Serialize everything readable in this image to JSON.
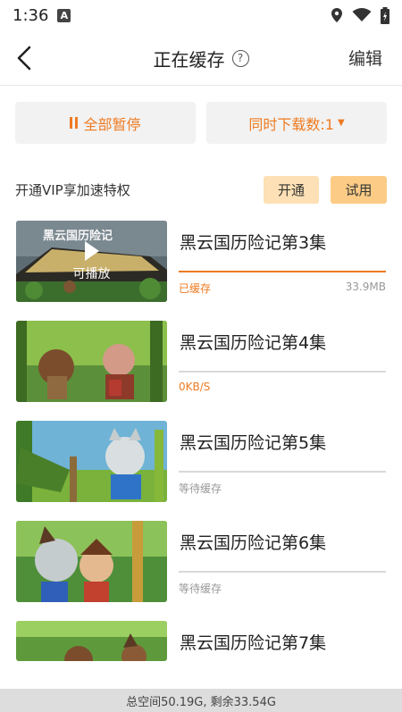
{
  "status_bar": {
    "time": "1:36",
    "notification_letter": "A"
  },
  "header": {
    "title": "正在缓存",
    "help_glyph": "?",
    "edit_label": "编辑"
  },
  "actions": {
    "pause_all_label": "全部暂停",
    "concurrent_label": "同时下载数:1"
  },
  "vip": {
    "promo_text": "开通VIP享加速特权",
    "open_label": "开通",
    "try_label": "试用"
  },
  "episodes": [
    {
      "title": "黑云国历险记第3集",
      "status": "已缓存",
      "size": "33.9MB",
      "progress": 1.0,
      "overlay_label": "可播放",
      "thumb_caption": "黑云国历险记",
      "status_color": "#ee7b22"
    },
    {
      "title": "黑云国历险记第4集",
      "status": "0KB/S",
      "size": "",
      "progress": 0,
      "status_color": "#ee7b22"
    },
    {
      "title": "黑云国历险记第5集",
      "status": "等待缓存",
      "size": "",
      "progress": 0,
      "status_color": "#999999"
    },
    {
      "title": "黑云国历险记第6集",
      "status": "等待缓存",
      "size": "",
      "progress": 0,
      "status_color": "#999999"
    },
    {
      "title": "黑云国历险记第7集",
      "status": "",
      "size": "",
      "progress": 0,
      "status_color": "#999999"
    }
  ],
  "footer": {
    "storage_text": "总空间50.19G, 剩余33.54G"
  },
  "colors": {
    "accent": "#ee7b22",
    "vip_open_bg": "#fde0b5",
    "vip_try_bg": "#fccc86"
  }
}
